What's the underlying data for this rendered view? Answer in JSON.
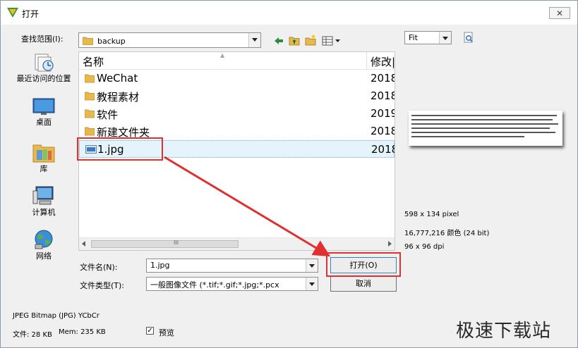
{
  "window": {
    "title": "打开",
    "close_glyph": "✕"
  },
  "look_in": {
    "label": "查找范围(I):",
    "value": "backup"
  },
  "zoom": {
    "value": "Fit"
  },
  "places": [
    {
      "label": "最近访问的位置",
      "icon": "recent-places-icon"
    },
    {
      "label": "桌面",
      "icon": "desktop-icon"
    },
    {
      "label": "库",
      "icon": "libraries-icon"
    },
    {
      "label": "计算机",
      "icon": "computer-icon"
    },
    {
      "label": "网络",
      "icon": "network-icon"
    }
  ],
  "filelist": {
    "col_name": "名称",
    "col_date": "修改|",
    "rows": [
      {
        "name": "WeChat",
        "date": "2018",
        "type": "folder"
      },
      {
        "name": "教程素材",
        "date": "2018",
        "type": "folder"
      },
      {
        "name": "软件",
        "date": "2019",
        "type": "folder"
      },
      {
        "name": "新建文件夹",
        "date": "2018",
        "type": "folder"
      },
      {
        "name": "1.jpg",
        "date": "2018",
        "type": "jpg",
        "selected": true
      }
    ],
    "scroll_grip": "III"
  },
  "filename": {
    "label": "文件名(N):",
    "value": "1.jpg"
  },
  "filetype": {
    "label": "文件类型(T):",
    "value": "一般图像文件 (*.tif;*.gif;*.jpg;*.pcx"
  },
  "buttons": {
    "open": "打开(O)",
    "cancel": "取消"
  },
  "image_info": {
    "size": "598 x 134 pixel",
    "colors": "16,777,216 颜色 (24 bit)",
    "dpi": "96 x 96 dpi"
  },
  "bottom": {
    "format": "JPEG Bitmap (JPG) YCbCr",
    "file_size": "文件: 28 KB",
    "mem": "Mem: 235 KB",
    "preview_label": "预览",
    "preview_checked": "✓"
  },
  "watermark": "极速下载站",
  "colors": {
    "highlight": "#e03030",
    "selection": "#e5f3fb",
    "folder": "#e8b84a"
  }
}
